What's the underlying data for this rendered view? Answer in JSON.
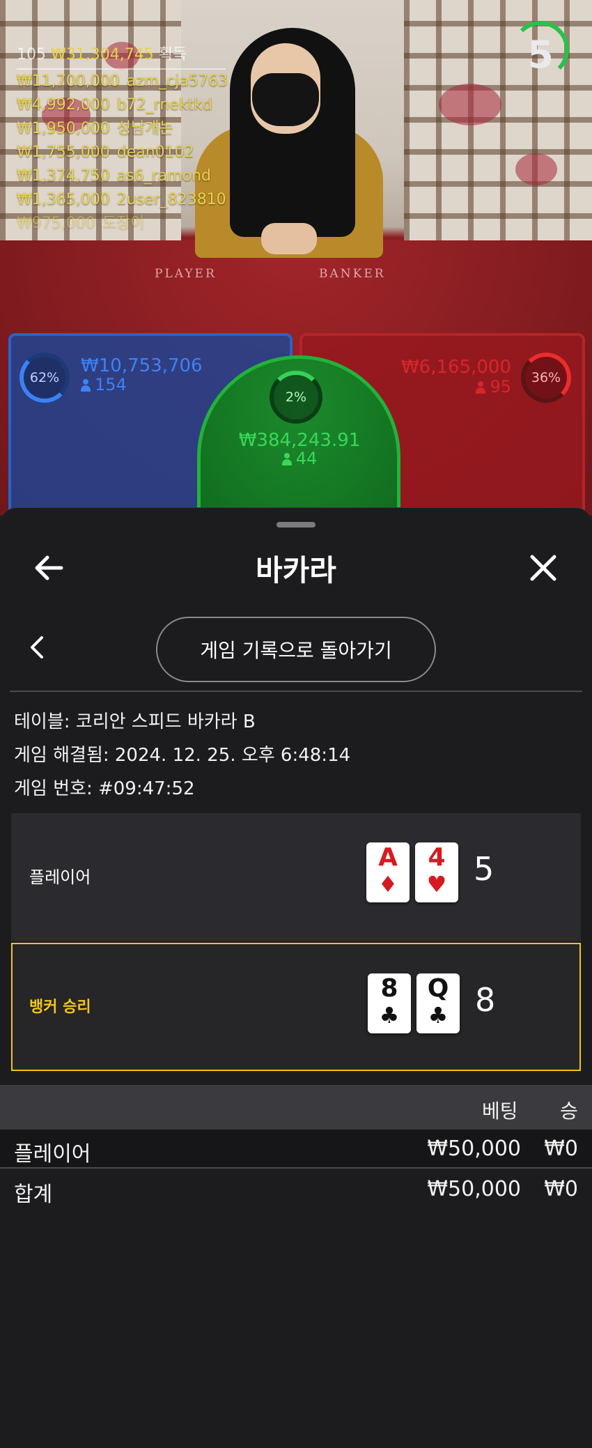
{
  "video": {
    "table_labels": {
      "player": "PLAYER",
      "banker": "BANKER"
    },
    "winners": {
      "count": "105",
      "total": "₩31,304,745",
      "total_suffix": "획득",
      "rows": [
        {
          "amount": "₩11,700,000",
          "user": "azm_cja5763"
        },
        {
          "amount": "₩4,992,000",
          "user": "b72_rnektkd"
        },
        {
          "amount": "₩1,950,000",
          "user": "성남개논"
        },
        {
          "amount": "₩1,755,000",
          "user": "dean0102"
        },
        {
          "amount": "₩1,374,750",
          "user": "as6_ramond"
        },
        {
          "amount": "₩1,365,000",
          "user": "2user_823810"
        },
        {
          "amount": "₩975,000",
          "user": "도장이"
        }
      ]
    },
    "timer": "5",
    "spots": {
      "player": {
        "percent": "62%",
        "amount": "₩10,753,706",
        "players": "154",
        "color": "#2a63c9"
      },
      "banker": {
        "percent": "36%",
        "amount": "₩6,165,000",
        "players": "95",
        "color": "#b52427"
      },
      "tie": {
        "percent": "2%",
        "amount": "₩384,243.91",
        "players": "44",
        "color": "#21b33a"
      }
    }
  },
  "sheet": {
    "title": "바카라",
    "back_icon": "arrow-left-icon",
    "close_icon": "close-icon",
    "sub_back_icon": "chevron-left-icon",
    "history_button": "게임 기록으로 돌아가기",
    "info": {
      "table": "테이블: 코리안 스피드 바카라 B",
      "resolved": "게임 해결됨: 2024. 12. 25. 오후 6:48:14",
      "number": "게임 번호: #09:47:52"
    },
    "results": {
      "player": {
        "label": "플레이어",
        "cards": [
          {
            "rank": "A",
            "suit": "♦",
            "color": "red"
          },
          {
            "rank": "4",
            "suit": "♥",
            "color": "red"
          }
        ],
        "score": "5"
      },
      "banker": {
        "label": "뱅커 승리",
        "cards": [
          {
            "rank": "8",
            "suit": "♣",
            "color": "black"
          },
          {
            "rank": "Q",
            "suit": "♣",
            "color": "black"
          }
        ],
        "score": "8",
        "highlight_color": "#f0c419"
      }
    },
    "bets_table": {
      "headers": {
        "bet": "베팅",
        "win": "승"
      },
      "rows": [
        {
          "name": "플레이어",
          "bet": "₩50,000",
          "win": "₩0"
        }
      ],
      "total": {
        "name": "합계",
        "bet": "₩50,000",
        "win": "₩0"
      }
    }
  }
}
